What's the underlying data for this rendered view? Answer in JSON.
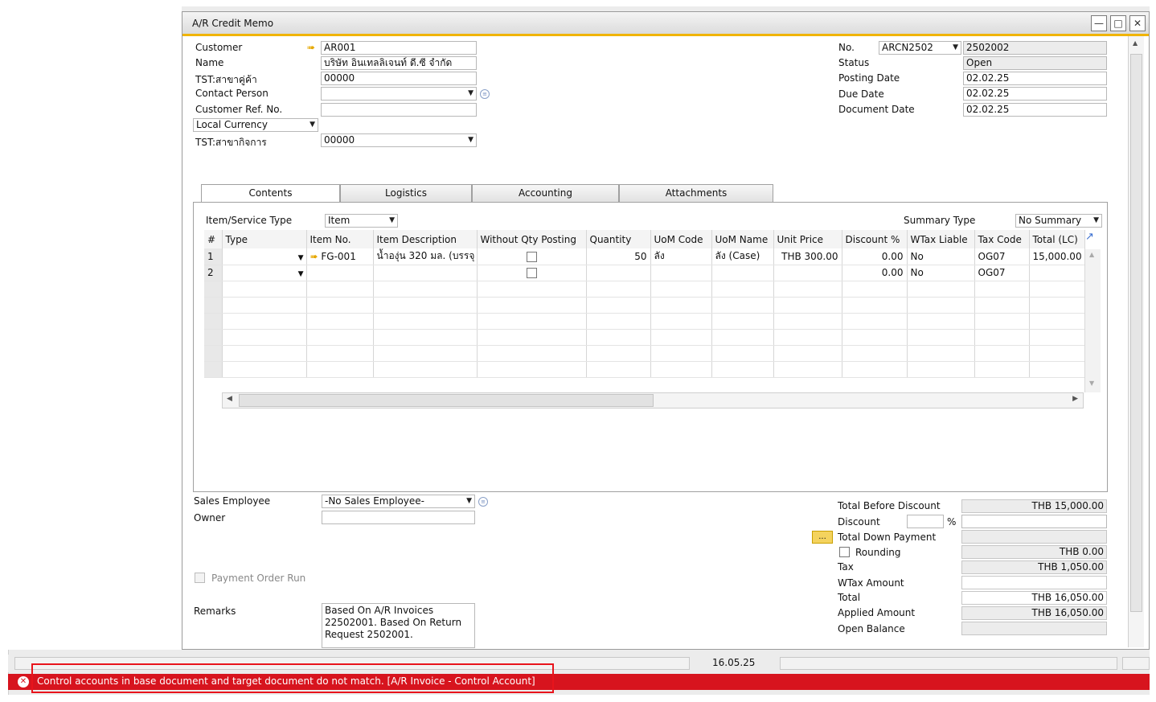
{
  "window": {
    "title": "A/R Credit Memo"
  },
  "header": {
    "customer_label": "Customer",
    "customer_value": "AR001",
    "name_label": "Name",
    "name_value": "บริษัท อินเทลลิเจนท์ ดี.ซี จำกัด",
    "branch_label": "TST:สาขาคู่ค้า",
    "branch_value": "00000",
    "contact_label": "Contact Person",
    "contact_value": "",
    "custref_label": "Customer Ref. No.",
    "custref_value": "",
    "currency_value": "Local Currency",
    "bizbranch_label": "TST:สาขากิจการ",
    "bizbranch_value": "00000",
    "no_label": "No.",
    "series_value": "ARCN2502",
    "no_value": "2502002",
    "status_label": "Status",
    "status_value": "Open",
    "posting_label": "Posting Date",
    "posting_value": "02.02.25",
    "due_label": "Due Date",
    "due_value": "02.02.25",
    "docdate_label": "Document Date",
    "docdate_value": "02.02.25"
  },
  "tabs": [
    {
      "label": "Contents",
      "active": true
    },
    {
      "label": "Logistics",
      "active": false
    },
    {
      "label": "Accounting",
      "active": false
    },
    {
      "label": "Attachments",
      "active": false
    }
  ],
  "contents": {
    "item_type_label": "Item/Service Type",
    "item_type_value": "Item",
    "summary_label": "Summary Type",
    "summary_value": "No Summary",
    "columns": [
      "#",
      "Type",
      "Item No.",
      "Item Description",
      "Without Qty Posting",
      "Quantity",
      "UoM Code",
      "UoM Name",
      "Unit Price",
      "Discount %",
      "WTax Liable",
      "Tax Code",
      "Total (LC)"
    ],
    "rows": [
      {
        "num": "1",
        "item_no": "FG-001",
        "desc": "น้ำองุ่น 320 มล. (บรรจุ",
        "qty": "50",
        "uom_code": "ลัง",
        "uom_name": "ลัง (Case)",
        "unit_price": "THB 300.00",
        "discount": "0.00",
        "wtax": "No",
        "tax_code": "OG07",
        "total": "15,000.00"
      },
      {
        "num": "2",
        "item_no": "",
        "desc": "",
        "qty": "",
        "uom_code": "",
        "uom_name": "",
        "unit_price": "",
        "discount": "0.00",
        "wtax": "No",
        "tax_code": "OG07",
        "total": ""
      }
    ]
  },
  "footer": {
    "sales_emp_label": "Sales Employee",
    "sales_emp_value": "-No Sales Employee-",
    "owner_label": "Owner",
    "owner_value": "",
    "payment_run_label": "Payment Order Run",
    "remarks_label": "Remarks",
    "remarks_value": "Based On A/R Invoices 22502001. Based On Return Request 2502001.",
    "total_before_discount_label": "Total Before Discount",
    "total_before_discount_value": "THB 15,000.00",
    "discount_label": "Discount",
    "discount_pct_symbol": "%",
    "total_down_payment_label": "Total Down Payment",
    "more_button_label": "...",
    "rounding_label": "Rounding",
    "rounding_value": "THB 0.00",
    "tax_label": "Tax",
    "tax_value": "THB 1,050.00",
    "wtax_label": "WTax Amount",
    "wtax_value": "",
    "total_label": "Total",
    "total_value": "THB 16,050.00",
    "applied_label": "Applied Amount",
    "applied_value": "THB 16,050.00",
    "open_balance_label": "Open Balance",
    "open_balance_value": ""
  },
  "statusbar": {
    "date": "16.05.25",
    "error_message": "Control accounts in base document and target document do not match.  [A/R Invoice - Control Account]"
  },
  "colors": {
    "accent": "#f0b400",
    "error": "#d7141e",
    "link_arrow": "#e6a800"
  }
}
